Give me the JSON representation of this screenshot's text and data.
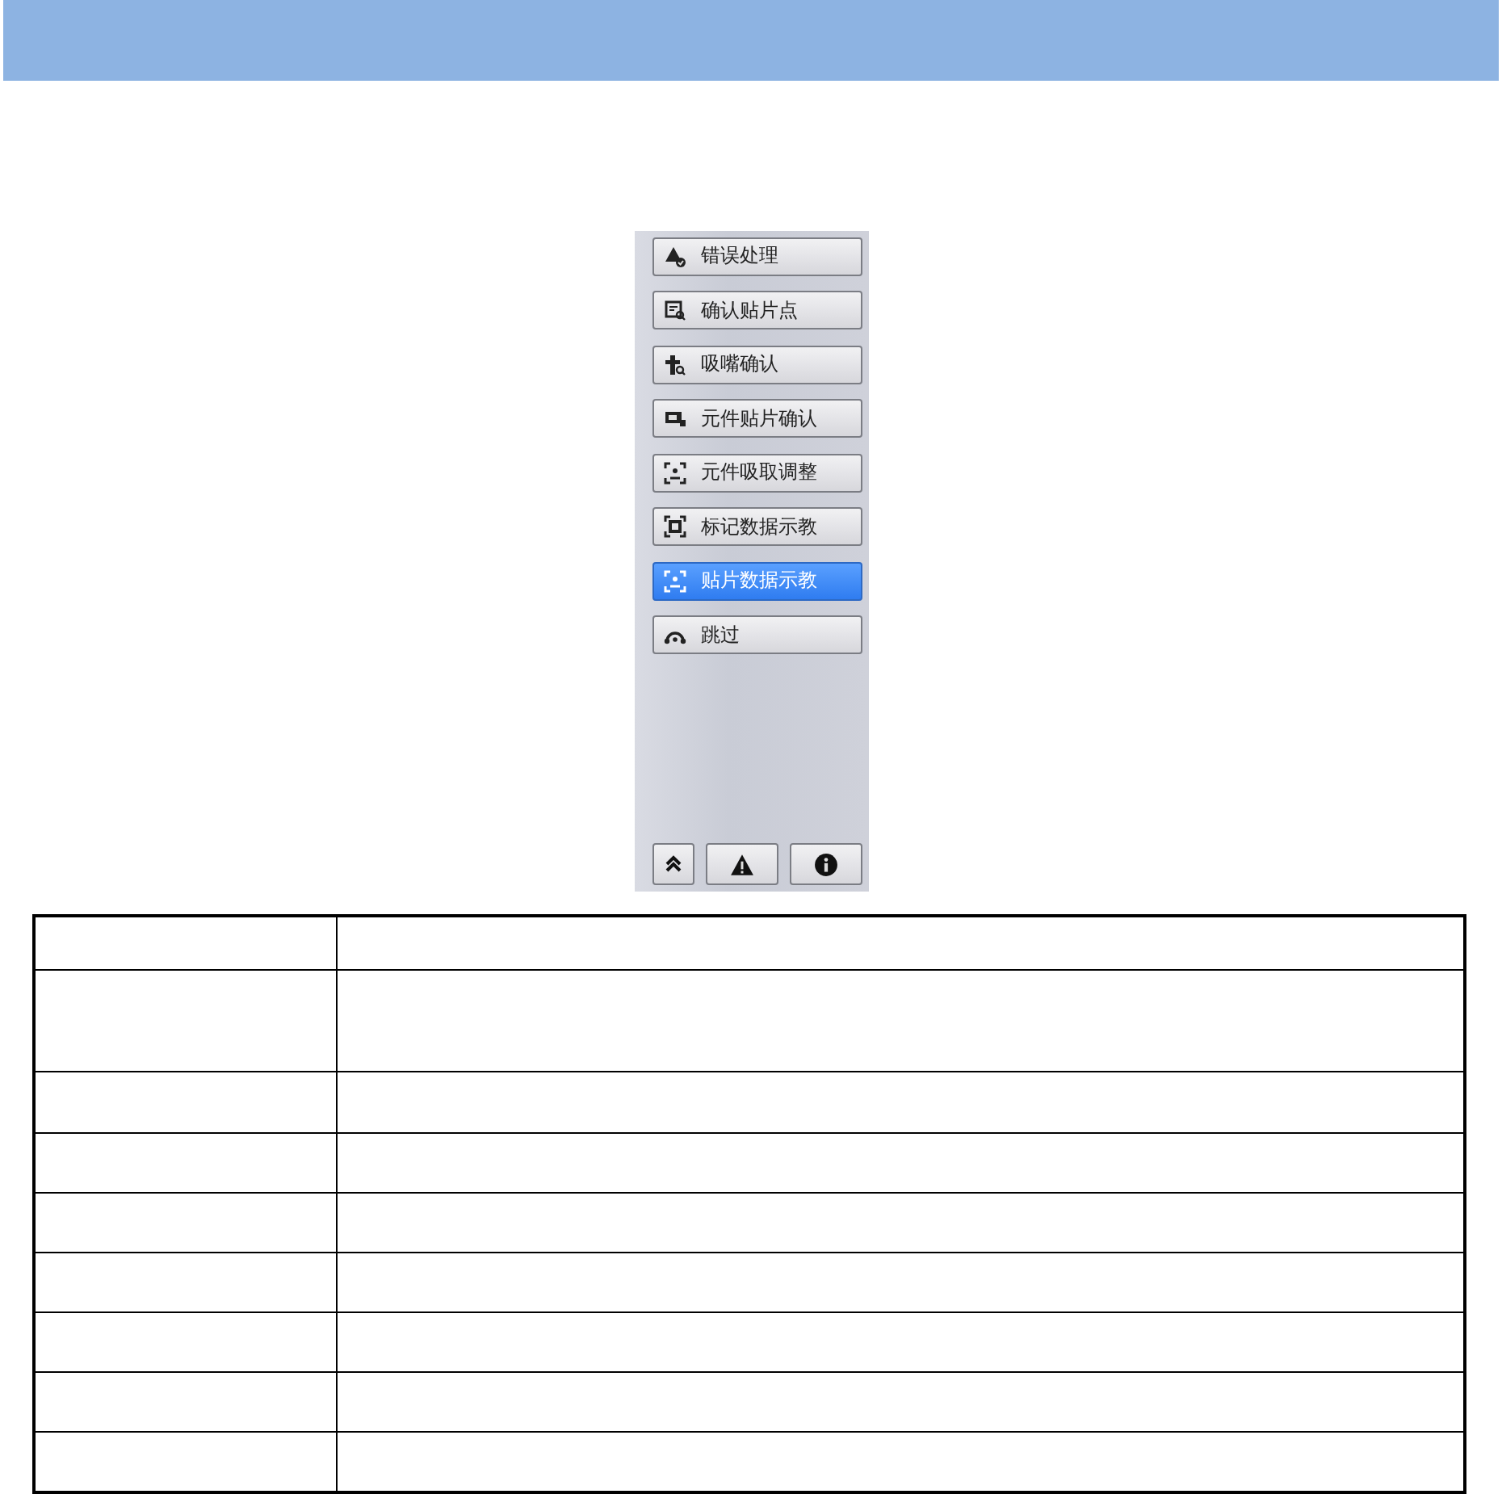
{
  "panel": {
    "buttons": [
      {
        "label": "错误处理",
        "selected": false
      },
      {
        "label": "确认贴片点",
        "selected": false
      },
      {
        "label": "吸嘴确认",
        "selected": false
      },
      {
        "label": "元件贴片确认",
        "selected": false
      },
      {
        "label": "元件吸取调整",
        "selected": false
      },
      {
        "label": "标记数据示教",
        "selected": false
      },
      {
        "label": "贴片数据示教",
        "selected": true
      },
      {
        "label": "跳过",
        "selected": false
      }
    ]
  }
}
